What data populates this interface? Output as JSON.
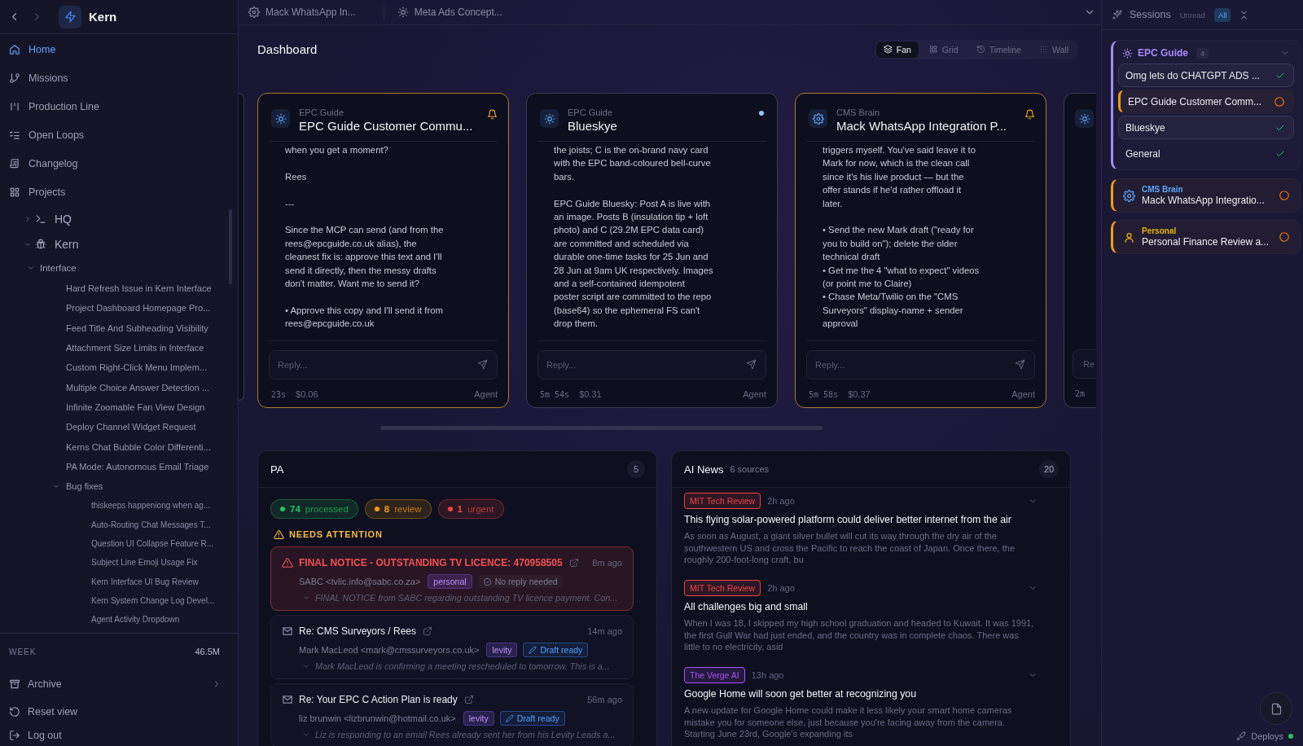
{
  "sidebar": {
    "history": [
      {
        "disabled": false
      },
      {
        "disabled": true
      }
    ],
    "brand": "Kern",
    "nav": [
      {
        "label": "Home",
        "selected": true
      },
      {
        "label": "Missions",
        "selected": false
      },
      {
        "label": "Production Line",
        "selected": false
      },
      {
        "label": "Open Loops",
        "selected": false
      },
      {
        "label": "Changelog",
        "selected": false
      },
      {
        "label": "Projects",
        "selected": false
      }
    ],
    "projects": [
      {
        "label": "HQ",
        "expanded": false
      },
      {
        "label": "Kern",
        "expanded": true,
        "children": [
          {
            "label": "Interface",
            "expanded": true,
            "children": [
              {
                "label": "Hard Refresh Issue in Kern Interface"
              },
              {
                "label": "Project Dashboard Homepage Pro..."
              },
              {
                "label": "Feed Title And Subheading Visibility"
              },
              {
                "label": "Attachment Size Limits in Interface"
              },
              {
                "label": "Custom Right-Click Menu Implem..."
              },
              {
                "label": "Multiple Choice Answer Detection ..."
              },
              {
                "label": "Infinite Zoomable Fan View Design"
              },
              {
                "label": "Deploy Channel Widget Request"
              },
              {
                "label": "Kerns Chat Bubble Color Differenti..."
              },
              {
                "label": "PA Mode: Autonomous Email Triage"
              },
              {
                "label": "Bug fixes",
                "expanded": true,
                "children": [
                  {
                    "label": "thiskeeps happeniong when ag..."
                  },
                  {
                    "label": "Auto-Routing Chat Messages T..."
                  },
                  {
                    "label": "Question UI Collapse Feature R..."
                  },
                  {
                    "label": "Subject Line Emoji Usage Fix"
                  },
                  {
                    "label": "Kern Interface UI Bug Review"
                  },
                  {
                    "label": "Kern System Change Log Devel..."
                  },
                  {
                    "label": "Agent Activity Dropdown"
                  }
                ]
              }
            ]
          }
        ]
      }
    ],
    "week": {
      "label": "WEEK",
      "value": "46.5M"
    },
    "footer": [
      {
        "label": "Archive",
        "chevron": true
      },
      {
        "label": "Reset view",
        "chevron": false
      },
      {
        "label": "Log out",
        "chevron": false
      }
    ]
  },
  "topbar": {
    "tabs": [
      {
        "label": "Mack WhatsApp In..."
      },
      {
        "label": "Meta Ads Concept..."
      }
    ]
  },
  "dashboard": {
    "title": "Dashboard",
    "views": [
      {
        "label": "Fan",
        "selected": true
      },
      {
        "label": "Grid",
        "selected": false
      },
      {
        "label": "Timeline",
        "selected": false
      },
      {
        "label": "Wall",
        "selected": false
      }
    ],
    "cards": [
      {
        "kind": "full",
        "workspace": "EPC Guide",
        "title": "EPC Guide Customer Commu...",
        "highlighted": true,
        "body": "when you get a moment?\n\nRees\n\n---\n\nSince the MCP can send (and from the\nrees@epcguide.co.uk alias), the\ncleanest fix is: approve this text and I'll\nsend it directly, then the messy drafts\ndon't matter. Want me to send it?\n\n• Approve this copy and I'll send it from\nrees@epcguide.co.uk",
        "reply_placeholder": "Reply...",
        "time": "23s",
        "cost": "$0.06",
        "actor": "Agent"
      },
      {
        "kind": "full",
        "workspace": "EPC Guide",
        "title": "Blueskye",
        "highlighted": false,
        "body": "the joists; C is the on-brand navy card\nwith the EPC band-coloured bell-curve\nbars.\n\nEPC Guide Bluesky: Post A is live with\nan image. Posts B (insulation tip + loft\nphoto) and C (29.2M EPC data card)\nare committed and scheduled via\ndurable one-time tasks for 25 Jun and\n28 Jun at 9am UK respectively. Images\nand a self-contained idempotent\nposter script are committed to the repo\n(base64) so the ephemeral FS can't\ndrop them.",
        "reply_placeholder": "Reply...",
        "time": "5m 54s",
        "cost": "$0.31",
        "actor": "Agent"
      },
      {
        "kind": "full",
        "workspace": "CMS Brain",
        "title": "Mack WhatsApp Integration P...",
        "highlighted": true,
        "body": "triggers myself. You've said leave it to\nMark for now, which is the clean call\nsince it's his live product — but the\noffer stands if he'd rather offload it\nlater.\n\n• Send the new Mark draft (\"ready for\nyou to build on\"); delete the older\ntechnical draft\n• Get me the 4 \"what to expect\" videos\n(or point me to Claire)\n• Chase Meta/Twilio on the \"CMS\nSurveyors\" display-name + sender\napproval",
        "reply_placeholder": "Reply...",
        "time": "5m 58s",
        "cost": "$0.37",
        "actor": "Agent"
      },
      {
        "kind": "partial",
        "reply_placeholder": "Re",
        "time": "2m"
      }
    ],
    "pa": {
      "title": "PA",
      "count": "5",
      "stats": [
        {
          "value": "74",
          "label": "processed",
          "color": "#22c55e"
        },
        {
          "value": "8",
          "label": "review",
          "color": "#f59e0b"
        },
        {
          "value": "1",
          "label": "urgent",
          "color": "#ef4444"
        }
      ],
      "section": "NEEDS ATTENTION",
      "emails": [
        {
          "kind": "urgent",
          "subject": "FINAL NOTICE - OUTSTANDING TV LICENCE: 470958505",
          "time": "8m ago",
          "sender": "SABC <tvlic.info@sabc.co.za>",
          "tag": "personal",
          "status": {
            "kind": "no_reply",
            "label": "No reply needed"
          },
          "summary": "FINAL NOTICE from SABC regarding outstanding TV licence payment. Con..."
        },
        {
          "kind": "normal",
          "subject": "Re: CMS Surveyors / Rees",
          "time": "14m ago",
          "sender": "Mark MacLeod <mark@cmssurveyors.co.uk>",
          "tag": "levity",
          "status": {
            "kind": "draft",
            "label": "Draft ready"
          },
          "summary": "Mark MacLeod is confirming a meeting rescheduled to tomorrow. This is a..."
        },
        {
          "kind": "normal",
          "subject": "Re: Your EPC C Action Plan is ready",
          "time": "56m ago",
          "sender": "liz brunwin <lizbrunwin@hotmail.co.uk>",
          "tag": "levity",
          "status": {
            "kind": "draft",
            "label": "Draft ready"
          },
          "summary": "Liz is responding to an email Rees already sent her from his Levity Leads a..."
        }
      ]
    },
    "news": {
      "title": "AI News",
      "sources": "6 sources",
      "count": "20",
      "items": [
        {
          "source": "MIT Tech Review",
          "color": "#ef4444",
          "time": "2h ago",
          "title": "This flying solar-powered platform could deliver better internet from the air",
          "summary": "As soon as August, a giant silver bullet will cut its way through the dry air of the\nsouthwestern US and cross the Pacific to reach the coast of Japan. Once there, the\nroughly 200-foot-long craft, bu"
        },
        {
          "source": "MIT Tech Review",
          "color": "#ef4444",
          "time": "2h ago",
          "title": "All challenges big and small",
          "summary": "When I was 18, I skipped my high school graduation and headed to Kuwait. It was 1991,\nthe first Gulf War had just ended, and the country was in complete chaos. There was\nlittle to no electricity, asid"
        },
        {
          "source": "The Verge AI",
          "color": "#a855f7",
          "time": "13h ago",
          "title": "Google Home will soon get better at recognizing you",
          "summary": "A new update for Google Home could make it less likely your smart home cameras\nmistake you for someone else, just because you're facing away from the camera.\nStarting June 23rd, Google's expanding its"
        }
      ]
    }
  },
  "sessions": {
    "title": "Sessions",
    "filters": [
      {
        "label": "Unread",
        "selected": false
      },
      {
        "label": "All",
        "selected": true
      }
    ],
    "groups": [
      {
        "kind": "group",
        "name": "EPC Guide",
        "color": "#a78bfa",
        "count": "4",
        "expanded": true,
        "items": [
          {
            "title": "Omg lets do CHATGPT ADS ...",
            "done": true,
            "selected": true
          },
          {
            "title": "EPC Guide Customer Comm...",
            "done": false,
            "selected": false
          },
          {
            "title": "Blueskye",
            "done": true,
            "selected": true
          },
          {
            "title": "General",
            "done": true,
            "selected": false
          }
        ]
      },
      {
        "kind": "single",
        "name": "CMS Brain",
        "color": "#60a5fa",
        "title": "Mack WhatsApp Integratio...",
        "done": false
      },
      {
        "kind": "single",
        "name": "Personal",
        "color": "#eab308",
        "title": "Personal Finance Review a...",
        "done": false
      }
    ]
  },
  "deploys": {
    "label": "Deploys",
    "online": true
  }
}
